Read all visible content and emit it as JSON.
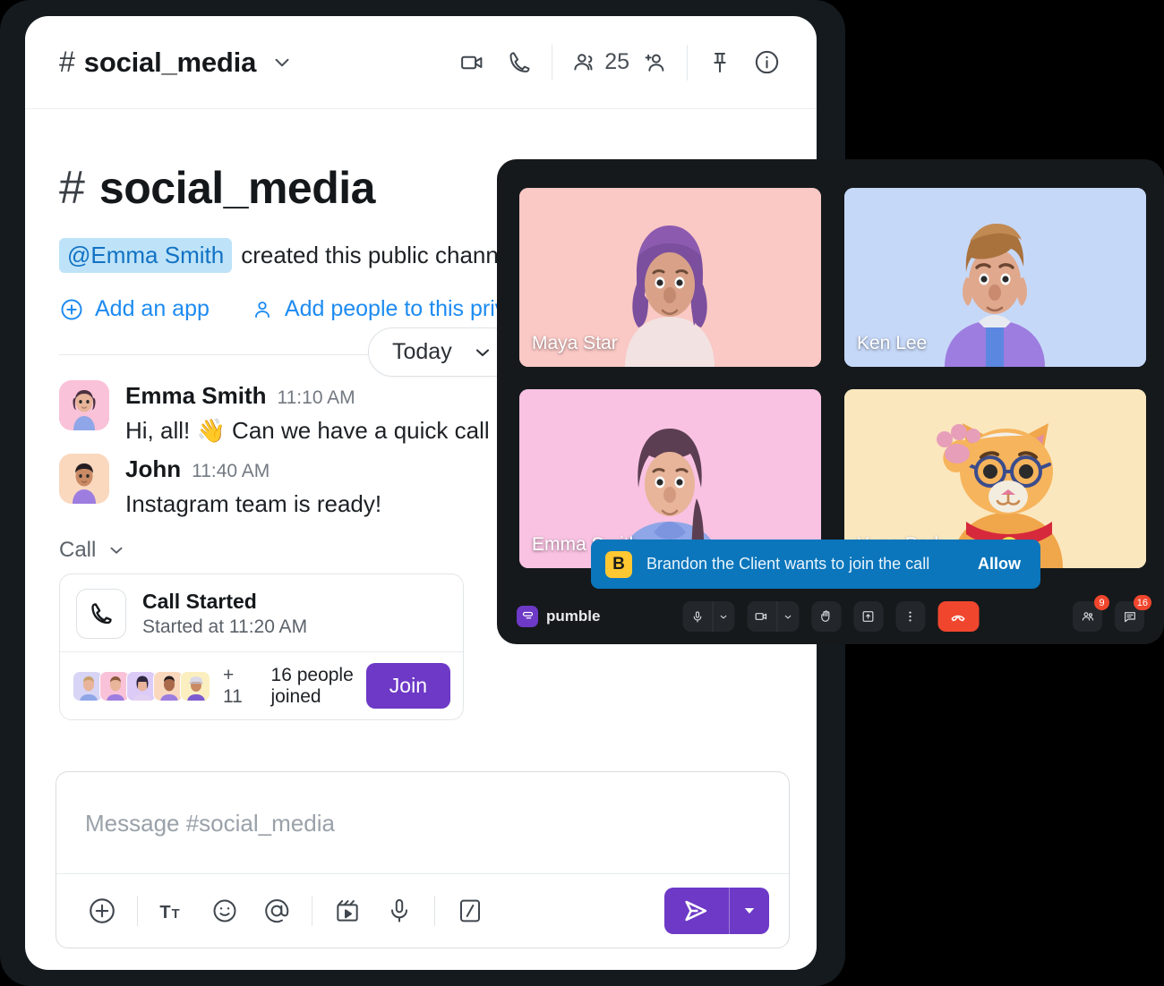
{
  "header": {
    "hash": "#",
    "channel_name": "social_media",
    "member_count": "25",
    "icons": [
      "video-camera-icon",
      "phone-icon",
      "members-icon",
      "add-person-icon",
      "pin-icon",
      "info-icon"
    ]
  },
  "intro": {
    "hash": "#",
    "channel_name": "social_media",
    "mention": "@Emma Smith",
    "created_text": "created this public chann",
    "add_app_label": "Add an app",
    "add_people_label": "Add people to this private"
  },
  "divider": {
    "today_label": "Today"
  },
  "messages": [
    {
      "author": "Emma Smith",
      "time": "11:10 AM",
      "text": "Hi, all! 👋  Can we have a quick call"
    },
    {
      "author": "John",
      "time": "11:40 AM",
      "text": "Instagram team is ready!"
    }
  ],
  "call_block": {
    "section_label": "Call",
    "title": "Call Started",
    "subtitle": "Started at 11:20 AM",
    "overflow_count": "+ 11",
    "joined_text": "16 people joined",
    "join_label": "Join",
    "accent_color": "#6D39C6"
  },
  "composer": {
    "placeholder": "Message #social_media",
    "value": "",
    "tools": [
      "plus-icon",
      "text-format-icon",
      "emoji-icon",
      "mention-icon",
      "clip-icon",
      "microphone-icon",
      "slash-command-icon"
    ],
    "send_icon": "send-icon",
    "send_caret_icon": "chevron-down-icon",
    "accent_color": "#6D39C6"
  },
  "call_panel": {
    "background": "#15191C",
    "tiles": [
      {
        "name": "Maya Star",
        "bg": "#FAC8C5",
        "avatar": "woman-purple-hair"
      },
      {
        "name": "Ken Lee",
        "bg": "#C6D8F8",
        "avatar": "man-brown-hair"
      },
      {
        "name": "Emma Smith",
        "bg": "#F9C2E2",
        "avatar": "woman-ponytail"
      },
      {
        "name": "Yuna Park",
        "bg": "#FBE7BE",
        "avatar": "cat-waving"
      }
    ],
    "toast": {
      "avatar_initial": "B",
      "text": "Brandon the Client wants to join the call",
      "action_label": "Allow",
      "background": "#0B76BC",
      "avatar_color": "#FFC832"
    },
    "brand": {
      "name": "pumble",
      "mark_color": "#6D39C6"
    },
    "controls": [
      {
        "name": "microphone",
        "has_chevron": true
      },
      {
        "name": "camera",
        "has_chevron": true
      },
      {
        "name": "raise-hand",
        "has_chevron": false
      },
      {
        "name": "screen-share",
        "has_chevron": false
      },
      {
        "name": "more-options",
        "has_chevron": false
      },
      {
        "name": "end-call",
        "has_chevron": false
      }
    ],
    "right_controls": [
      {
        "name": "participants",
        "badge": "9"
      },
      {
        "name": "chat",
        "badge": "16"
      }
    ],
    "end_call_color": "#F0462D"
  }
}
